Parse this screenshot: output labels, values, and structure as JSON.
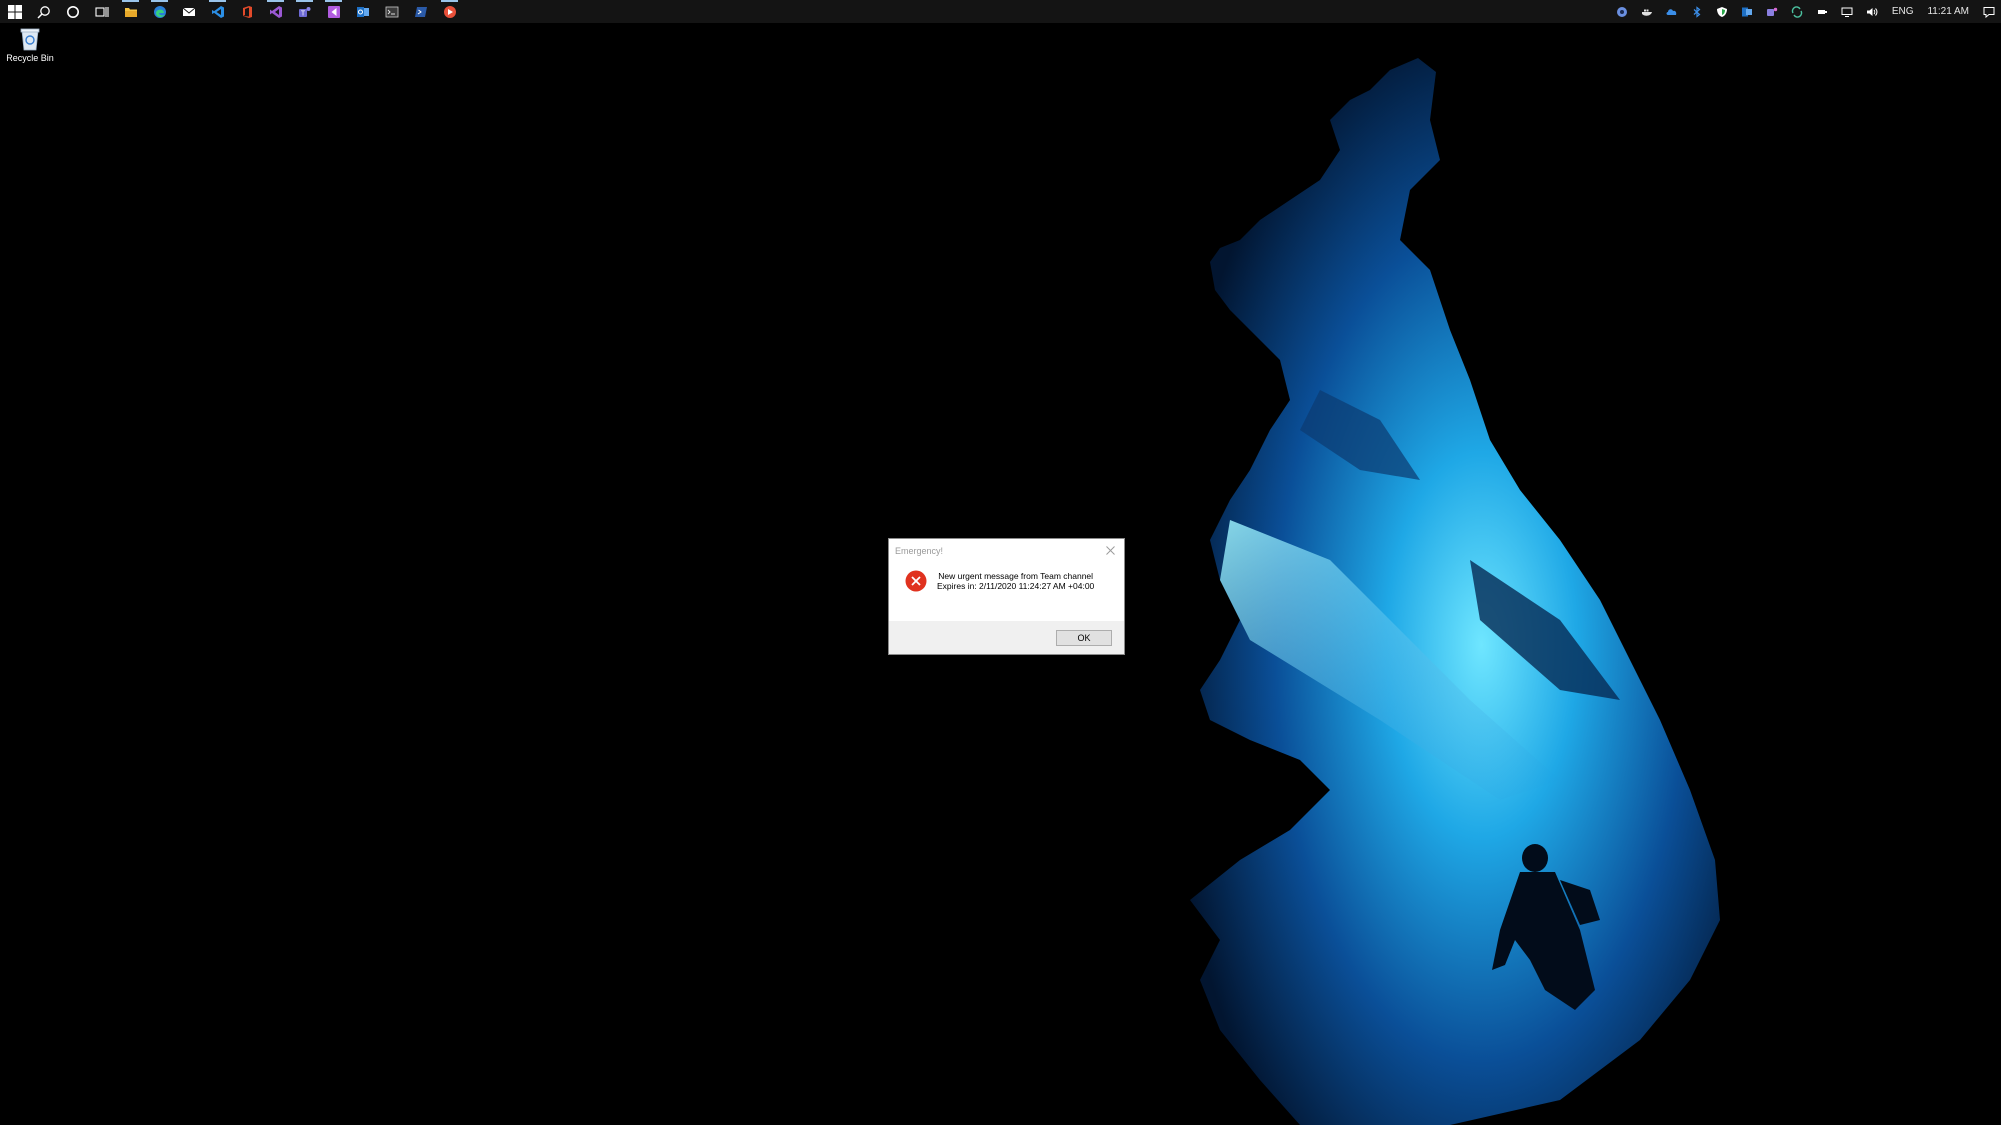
{
  "desktop": {
    "wallpaper": "underwater-cave-diver",
    "icons": [
      {
        "label": "Recycle Bin",
        "icon": "recycle-bin-icon"
      }
    ]
  },
  "taskbar": {
    "pinned": [
      {
        "name": "start",
        "icon": "windows-logo-icon",
        "color": "#ffffff"
      },
      {
        "name": "search",
        "icon": "search-icon",
        "color": "#ffffff"
      },
      {
        "name": "cortana",
        "icon": "cortana-circle-icon",
        "color": "#ffffff"
      },
      {
        "name": "task-view",
        "icon": "task-view-icon",
        "color": "#ffffff"
      },
      {
        "name": "file-explorer",
        "icon": "folder-icon",
        "color": "#f4c344"
      },
      {
        "name": "edge",
        "icon": "edge-icon",
        "color": "#36b37e"
      },
      {
        "name": "mail",
        "icon": "mail-icon",
        "color": "#ffffff"
      },
      {
        "name": "vscode",
        "icon": "vscode-icon",
        "color": "#2b8fe6"
      },
      {
        "name": "office",
        "icon": "office-icon",
        "color": "#e34a2a"
      },
      {
        "name": "visual-studio",
        "icon": "visual-studio-icon",
        "color": "#9b59d4"
      },
      {
        "name": "teams",
        "icon": "teams-icon",
        "color": "#6e6ad4"
      },
      {
        "name": "visual-studio-preview",
        "icon": "vs-preview-icon",
        "color": "#b15ce0"
      },
      {
        "name": "outlook",
        "icon": "outlook-icon",
        "color": "#2f86d6"
      },
      {
        "name": "terminal",
        "icon": "terminal-icon",
        "color": "#cccccc"
      },
      {
        "name": "powershell",
        "icon": "powershell-icon",
        "color": "#2a5aa8"
      },
      {
        "name": "app-red",
        "icon": "red-app-icon",
        "color": "#e8503a"
      }
    ],
    "tray": {
      "icons": [
        {
          "name": "tray-app-1",
          "icon": "shield-circle-icon",
          "color": "#6a8fe0"
        },
        {
          "name": "tray-app-2",
          "icon": "docker-whale-icon",
          "color": "#e0e0e0"
        },
        {
          "name": "onedrive",
          "icon": "cloud-icon",
          "color": "#3b8ee8"
        },
        {
          "name": "bluetooth",
          "icon": "bluetooth-icon",
          "color": "#3b8ee8"
        },
        {
          "name": "defender",
          "icon": "shield-icon",
          "color": "#ffffff"
        },
        {
          "name": "outlook-tray",
          "icon": "outlook-icon",
          "color": "#2f86d6"
        },
        {
          "name": "teams-tray",
          "icon": "teams-icon",
          "color": "#8a7fe0"
        },
        {
          "name": "sync",
          "icon": "sync-icon",
          "color": "#4cc2a0"
        },
        {
          "name": "usb",
          "icon": "usb-icon",
          "color": "#ffffff"
        },
        {
          "name": "network",
          "icon": "network-icon",
          "color": "#ffffff"
        },
        {
          "name": "volume",
          "icon": "volume-icon",
          "color": "#ffffff"
        }
      ],
      "language": "ENG",
      "time": "11:21 AM",
      "notifications_icon": "notification-icon"
    }
  },
  "dialog": {
    "title": "Emergency!",
    "icon": "error-icon",
    "icon_color": "#e0321f",
    "message_line1": "New urgent message from Team channel",
    "message_line2": "Expires in: 2/11/2020 11:24:27 AM +04:00",
    "ok_label": "OK"
  }
}
